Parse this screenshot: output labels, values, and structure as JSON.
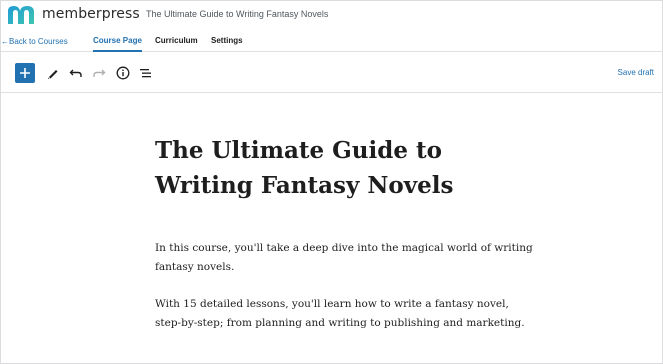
{
  "app": {
    "brand": "memberpress",
    "doc_title": "The Ultimate Guide to Writing Fantasy Novels",
    "accent_color": "#2271b1"
  },
  "nav": {
    "back_label": "Back to Courses",
    "tabs": [
      {
        "label": "Course Page",
        "active": true
      },
      {
        "label": "Curriculum",
        "active": false
      },
      {
        "label": "Settings",
        "active": false
      }
    ]
  },
  "toolbar": {
    "icons": [
      "plus-icon",
      "pencil-icon",
      "undo-icon",
      "redo-icon",
      "info-icon",
      "list-view-icon"
    ],
    "save_label": "Save draft"
  },
  "content": {
    "title": "The Ultimate Guide to Writing Fantasy Novels",
    "paragraphs": [
      "In this course, you'll take a deep dive into the magical world of writing fantasy novels.",
      "With 15 detailed lessons, you'll learn how to write a fantasy novel, step-by-step; from planning and writing to publishing and marketing."
    ]
  }
}
